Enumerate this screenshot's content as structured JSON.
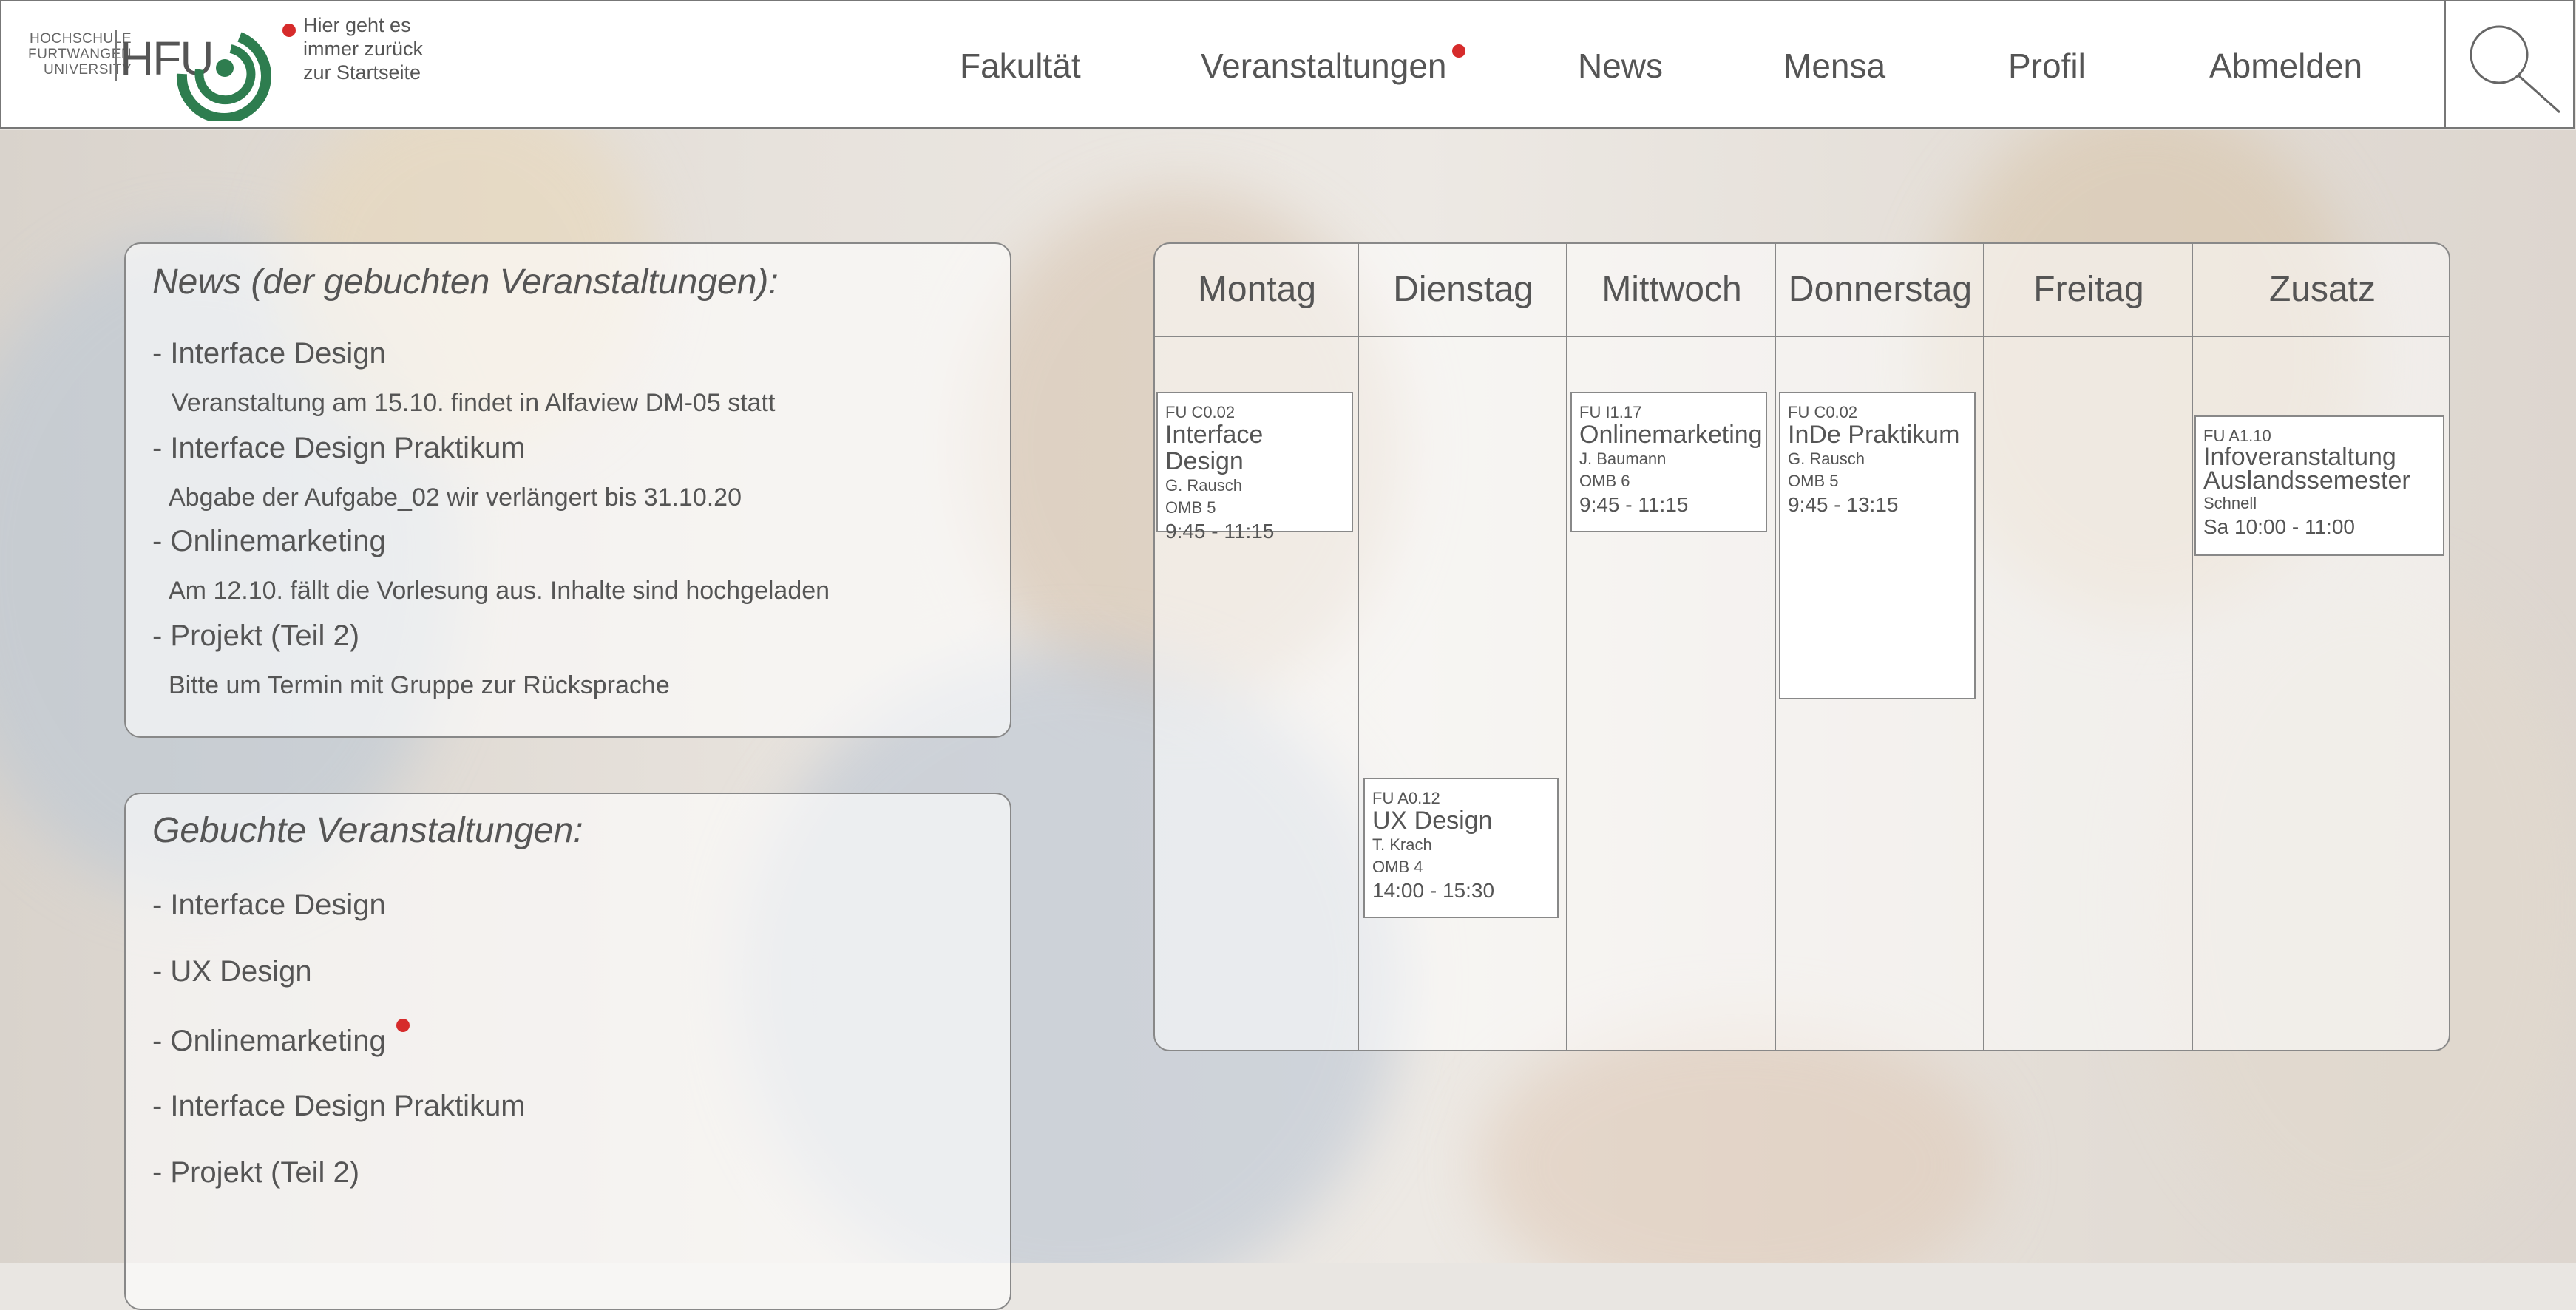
{
  "header": {
    "logo": {
      "small_text": [
        "HOCHSCHULE",
        "FURTWANGEN",
        "UNIVERSITY"
      ],
      "brand": "HFU"
    },
    "home_hint": [
      "Hier geht es",
      "immer zurück",
      "zur Startseite"
    ],
    "nav": [
      "Fakultät",
      "Veranstaltungen",
      "News",
      "Mensa",
      "Profil",
      "Abmelden"
    ],
    "search_icon": "magnifier-icon"
  },
  "news": {
    "title": "News (der gebuchten Veranstaltungen):",
    "items": [
      {
        "label": "- Interface Design",
        "detail": "Veranstaltung am 15.10. findet in Alfaview DM-05 statt"
      },
      {
        "label": "- Interface Design Praktikum",
        "detail": "Abgabe der Aufgabe_02 wir verlängert bis 31.10.20"
      },
      {
        "label": "- Onlinemarketing",
        "detail": "Am 12.10. fällt die Vorlesung aus. Inhalte sind hochgeladen"
      },
      {
        "label": "- Projekt (Teil 2)",
        "detail": "Bitte um Termin mit Gruppe zur Rücksprache"
      }
    ]
  },
  "booked": {
    "title": "Gebuchte Veranstaltungen:",
    "items": [
      "- Interface Design",
      "- UX Design",
      "- Onlinemarketing",
      "- Interface Design Praktikum",
      "- Projekt (Teil 2)"
    ]
  },
  "schedule": {
    "days": [
      "Montag",
      "Dienstag",
      "Mittwoch",
      "Donnerstag",
      "Freitag",
      "Zusatz"
    ],
    "events": [
      {
        "room": "FU C0.02",
        "title": "Interface Design",
        "lecturer": "G. Rausch",
        "location": "OMB 5",
        "time": "9:45 - 11:15"
      },
      {
        "room": "FU A0.12",
        "title": "UX Design",
        "lecturer": "T. Krach",
        "location": "OMB 4",
        "time": "14:00 - 15:30"
      },
      {
        "room": "FU I1.17",
        "title": "Onlinemarketing",
        "lecturer": "J. Baumann",
        "location": "OMB 6",
        "time": "9:45 - 11:15"
      },
      {
        "room": "FU C0.02",
        "title": "InDe Praktikum",
        "lecturer": "G. Rausch",
        "location": "OMB 5",
        "time": "9:45 - 13:15"
      },
      {
        "room": "FU A1.10",
        "title": "Infoveranstaltung Auslandssemester",
        "lecturer": "Schnell",
        "location": "",
        "time": "Sa 10:00 - 11:00"
      }
    ]
  },
  "colors": {
    "accent_green": "#2e7d4f",
    "notification_red": "#d62b2b"
  }
}
